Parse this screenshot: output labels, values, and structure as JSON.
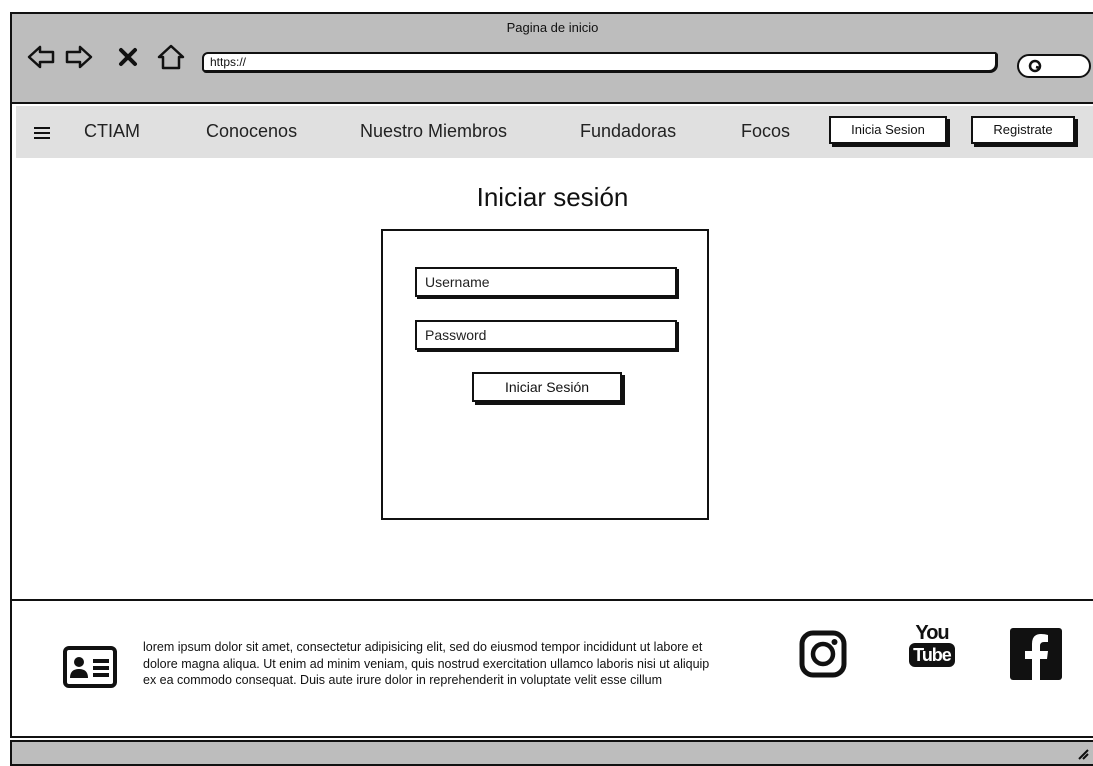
{
  "window": {
    "title": "Pagina de inicio"
  },
  "browser": {
    "url": "https://",
    "icons": [
      "back-arrow-icon",
      "forward-arrow-icon",
      "close-x-icon",
      "home-icon",
      "search-icon"
    ]
  },
  "menu": {
    "brand": "CTIAM",
    "items": [
      {
        "label": "Conocenos"
      },
      {
        "label": "Nuestro Miembros"
      },
      {
        "label": "Fundadoras"
      },
      {
        "label": "Focos"
      }
    ],
    "login_button": "Inicia Sesion",
    "register_button": "Registrate"
  },
  "login": {
    "title": "Iniciar sesión",
    "username_placeholder": "Username",
    "password_placeholder": "Password",
    "submit_label": "Iniciar Sesión"
  },
  "footer": {
    "text": "lorem ipsum dolor sit amet, consectetur adipisicing elit, sed do eiusmod tempor incididunt ut labore et dolore magna aliqua. Ut enim ad minim veniam, quis nostrud exercitation ullamco laboris nisi ut aliquip ex ea commodo consequat. Duis aute irure dolor in reprehenderit in voluptate velit esse cillum",
    "youtube_top": "You",
    "youtube_bottom": "Tube",
    "social_icons": [
      "instagram-icon",
      "youtube-icon",
      "facebook-icon"
    ]
  }
}
